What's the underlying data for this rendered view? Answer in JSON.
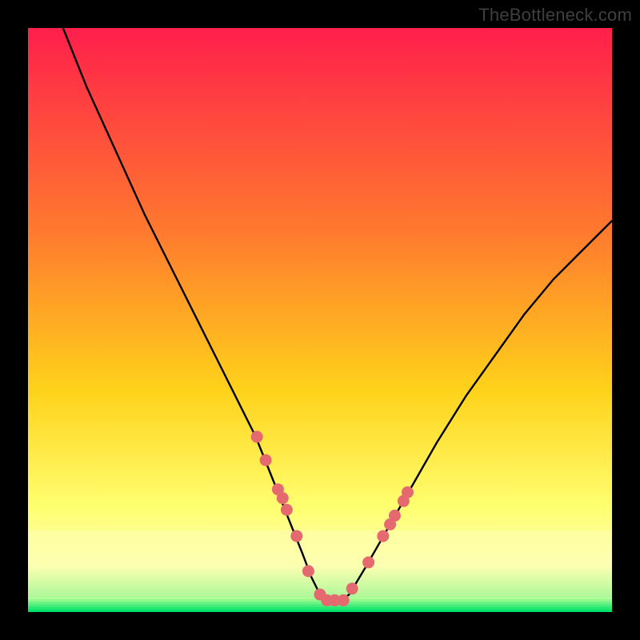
{
  "watermark": "TheBottleneck.com",
  "colors": {
    "gradient_top": "#ff1f4b",
    "gradient_mid1": "#ff7a2e",
    "gradient_mid2": "#ffd21a",
    "gradient_mid3": "#ffff70",
    "gradient_mid4": "#fdffb0",
    "gradient_bottom": "#00e86b",
    "curve": "#000000",
    "dot": "#e46a6f",
    "frame": "#000000"
  },
  "chart_data": {
    "type": "line",
    "title": "",
    "xlabel": "",
    "ylabel": "",
    "xlim": [
      0,
      100
    ],
    "ylim": [
      0,
      100
    ],
    "annotations": [],
    "series": [
      {
        "name": "bottleneck-curve",
        "x": [
          6,
          10,
          15,
          20,
          25,
          30,
          33,
          36,
          39,
          41,
          43,
          45,
          47,
          48.5,
          50,
          51.5,
          53,
          55,
          58,
          62,
          66,
          70,
          75,
          80,
          85,
          90,
          95,
          100
        ],
        "y": [
          100,
          90,
          79,
          68,
          58,
          48,
          42,
          36,
          30,
          25,
          20,
          15,
          10,
          6,
          3,
          1.5,
          1.5,
          3,
          8,
          15,
          22,
          29,
          37,
          44,
          51,
          57,
          62,
          67
        ]
      }
    ],
    "dots": {
      "name": "sample-points",
      "x": [
        39.2,
        40.7,
        42.8,
        43.6,
        44.3,
        46.0,
        48.0,
        50.0,
        51.2,
        52.5,
        54.0,
        55.5,
        58.3,
        60.8,
        62.0,
        62.8,
        64.3,
        65.0
      ],
      "y": [
        30.0,
        26.0,
        21.0,
        19.5,
        17.5,
        13.0,
        7.0,
        3.0,
        2.0,
        2.0,
        2.0,
        4.0,
        8.5,
        13.0,
        15.0,
        16.5,
        19.0,
        20.5
      ]
    },
    "green_band": {
      "from_y": 0,
      "to_y": 2.5
    },
    "pale_band": {
      "from_y": 2.5,
      "to_y": 14
    }
  }
}
